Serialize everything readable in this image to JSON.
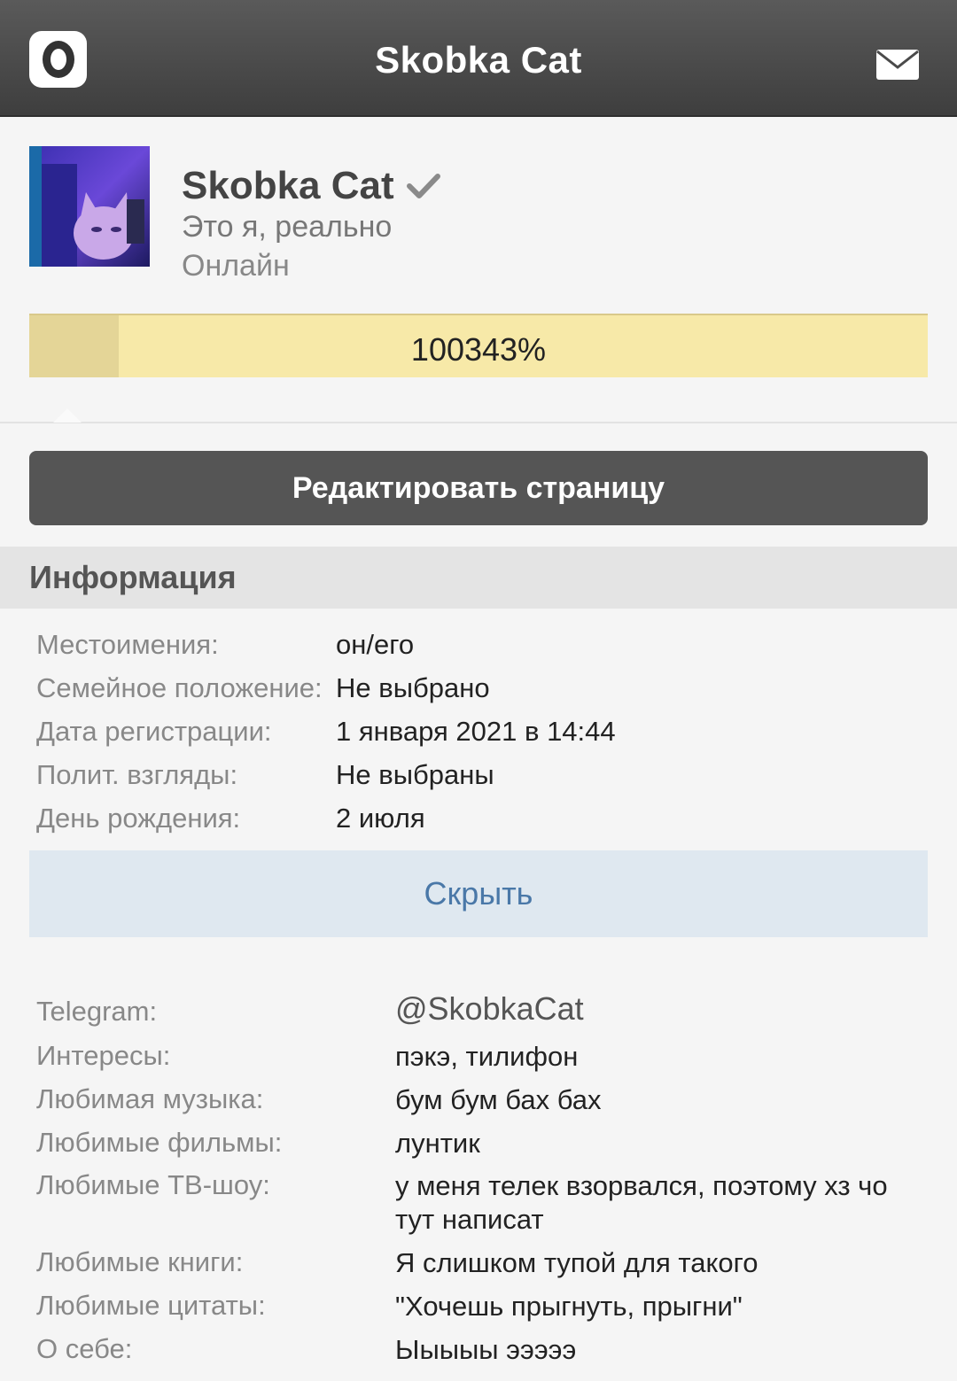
{
  "header": {
    "title": "Skobka Cat",
    "logo_icon": "app-logo-icon",
    "mail_icon": "mail-icon"
  },
  "profile": {
    "name": "Skobka Cat",
    "verified_icon": "checkmark-icon",
    "status": "Это я, реально",
    "online": "Онлайн",
    "rating": "100343%"
  },
  "actions": {
    "edit_label": "Редактировать страницу",
    "hide_label": "Скрыть"
  },
  "info": {
    "title": "Информация",
    "rows": [
      {
        "label": "Местоимения:",
        "value": "он/его"
      },
      {
        "label": "Семейное положение:",
        "value": "Не выбрано"
      },
      {
        "label": "Дата регистрации:",
        "value": "1 января 2021 в 14:44"
      },
      {
        "label": "Полит. взгляды:",
        "value": "Не выбраны"
      },
      {
        "label": "День рождения:",
        "value": "2 июля"
      }
    ]
  },
  "contacts": {
    "rows": [
      {
        "label": "Telegram:",
        "value": "@SkobkaCat"
      },
      {
        "label": "Интересы:",
        "value": "пэкэ, тилифон"
      },
      {
        "label": "Любимая музыка:",
        "value": "бум бум бах бах"
      },
      {
        "label": "Любимые фильмы:",
        "value": "лунтик"
      },
      {
        "label": "Любимые ТВ-шоу:",
        "value": "у меня телек взорвался, поэтому хз чо тут написат"
      },
      {
        "label": "Любимые книги:",
        "value": "Я слишком тупой для такого"
      },
      {
        "label": "Любимые цитаты:",
        "value": "\"Хочешь прыгнуть, прыгни\""
      },
      {
        "label": "О себе:",
        "value": "Ыыыыы эээээ"
      }
    ]
  },
  "colors": {
    "topbar": "#4a4a4a",
    "rating_bar": "#f7e9a8",
    "hide_button": "#dfe8f0",
    "hide_text": "#4a78a8"
  }
}
